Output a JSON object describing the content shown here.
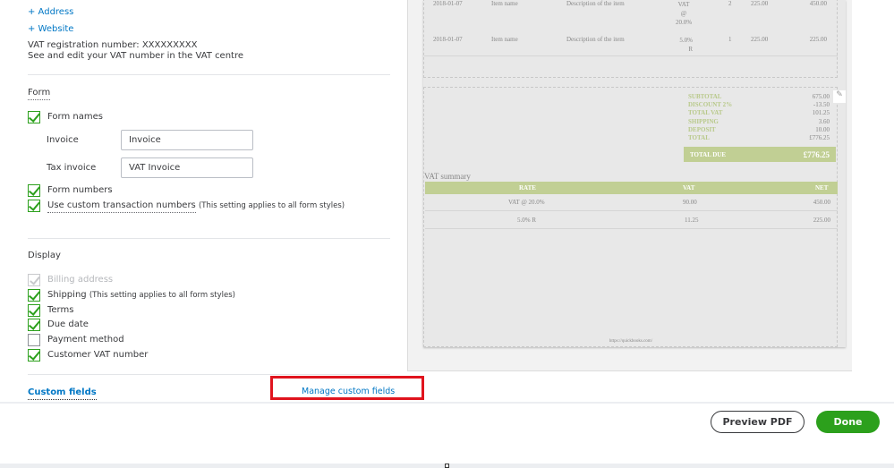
{
  "company": {
    "address_link": "+ Address",
    "website_link": "+ Website",
    "vat_reg": "VAT registration number: XXXXXXXXX",
    "vat_note": "See and edit your VAT number in the VAT centre"
  },
  "form": {
    "title": "Form",
    "form_names": {
      "label": "Form names",
      "checked": true
    },
    "invoice_label": "Invoice",
    "invoice_value": "Invoice",
    "tax_invoice_label": "Tax invoice",
    "tax_invoice_value": "VAT Invoice",
    "form_numbers": {
      "label": "Form numbers",
      "checked": true
    },
    "custom_numbers": {
      "label": "Use custom transaction numbers",
      "note": "(This setting applies to all form styles)",
      "checked": true
    }
  },
  "display": {
    "title": "Display",
    "items": [
      {
        "label": "Billing address",
        "note": "",
        "checked": true,
        "disabled": true
      },
      {
        "label": "Shipping",
        "note": "(This setting applies to all form styles)",
        "checked": true
      },
      {
        "label": "Terms",
        "note": "",
        "checked": true
      },
      {
        "label": "Due date",
        "note": "",
        "checked": true
      },
      {
        "label": "Payment method",
        "note": "",
        "checked": false
      },
      {
        "label": "Customer VAT number",
        "note": "",
        "checked": true
      }
    ]
  },
  "custom_fields": {
    "title": "Custom fields",
    "manage_link": "Manage custom fields"
  },
  "preview": {
    "lines": [
      {
        "date": "2018-01-07",
        "item": "Item name",
        "desc": "Description of the item",
        "vat": "VAT @ 20.0%",
        "qty": "2",
        "rate": "225.00",
        "amount": "450.00"
      },
      {
        "date": "2018-01-07",
        "item": "Item name",
        "desc": "Description of the item",
        "vat": "5.0% R",
        "qty": "1",
        "rate": "225.00",
        "amount": "225.00"
      }
    ],
    "totals": [
      {
        "label": "SUBTOTAL",
        "value": "675.00"
      },
      {
        "label": "DISCOUNT 2%",
        "value": "-13.50"
      },
      {
        "label": "TOTAL VAT",
        "value": "101.25"
      },
      {
        "label": "SHIPPING",
        "value": "3.60"
      },
      {
        "label": "DEPOSIT",
        "value": "10.00"
      },
      {
        "label": "TOTAL",
        "value": "£776.25"
      }
    ],
    "total_due_label": "TOTAL DUE",
    "total_due_value": "£776.25",
    "vat_summary_title": "VAT summary",
    "vat_headers": [
      "RATE",
      "VAT",
      "NET"
    ],
    "vat_rows": [
      [
        "VAT @ 20.0%",
        "90.00",
        "450.00"
      ],
      [
        "5.0% R",
        "11.25",
        "225.00"
      ]
    ],
    "url": "https://quickbooks.com/",
    "accent": "#c1cf94"
  },
  "footer": {
    "preview_pdf": "Preview PDF",
    "done": "Done",
    "done_color": "#2ca01c"
  }
}
